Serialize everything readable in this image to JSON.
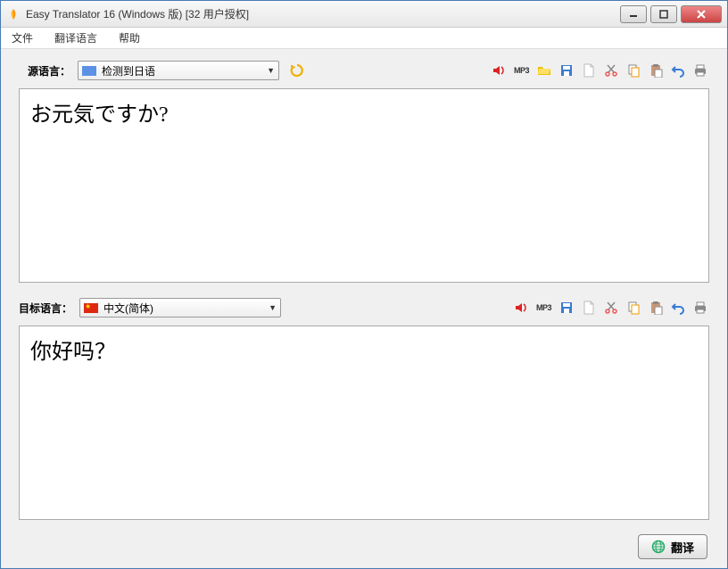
{
  "window": {
    "title": "Easy Translator 16 (Windows 版) [32 用户授权]"
  },
  "menubar": {
    "file": "文件",
    "langs": "翻译语言",
    "help": "帮助"
  },
  "source": {
    "label": "源语言：",
    "selected": "检测到日语",
    "text": "お元気ですか?"
  },
  "target": {
    "label": "目标语言：",
    "selected": "中文(简体)",
    "text": "你好吗？"
  },
  "toolbar": {
    "mp3": "MP3"
  },
  "footer": {
    "translate": "翻译"
  }
}
